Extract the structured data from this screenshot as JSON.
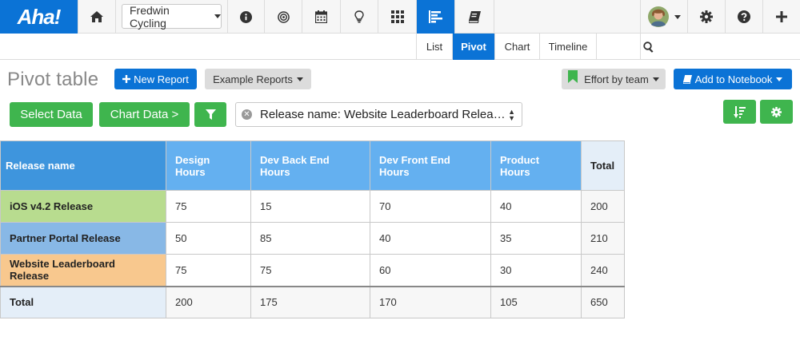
{
  "app": {
    "logo": "Aha!"
  },
  "workspace": {
    "name": "Fredwin Cycling"
  },
  "subtabs": [
    "List",
    "Pivot",
    "Chart",
    "Timeline"
  ],
  "page": {
    "title": "Pivot table"
  },
  "buttons": {
    "new_report": "New Report",
    "example_reports": "Example Reports",
    "effort_by_team": "Effort by team",
    "add_to_notebook": "Add to Notebook",
    "select_data": "Select Data",
    "chart_data": "Chart Data >"
  },
  "filter": {
    "value": "Release name: Website Leaderboard Relea…"
  },
  "table": {
    "row_header": "Release name",
    "columns": [
      "Design Hours",
      "Dev Back End Hours",
      "Dev Front End Hours",
      "Product Hours",
      "Total"
    ],
    "rows": [
      {
        "name": "iOS v4.2 Release",
        "color": "#b8dc8f",
        "values": [
          "75",
          "15",
          "70",
          "40",
          "200"
        ]
      },
      {
        "name": "Partner Portal Release",
        "color": "#88b8e6",
        "values": [
          "50",
          "85",
          "40",
          "35",
          "210"
        ]
      },
      {
        "name": "Website Leaderboard Release",
        "color": "#f8c88e",
        "values": [
          "75",
          "75",
          "60",
          "30",
          "240"
        ]
      }
    ],
    "total_row": {
      "name": "Total",
      "values": [
        "200",
        "175",
        "170",
        "105",
        "650"
      ]
    }
  },
  "colors": {
    "accent": "#0b73d6",
    "green": "#3fb54e"
  }
}
